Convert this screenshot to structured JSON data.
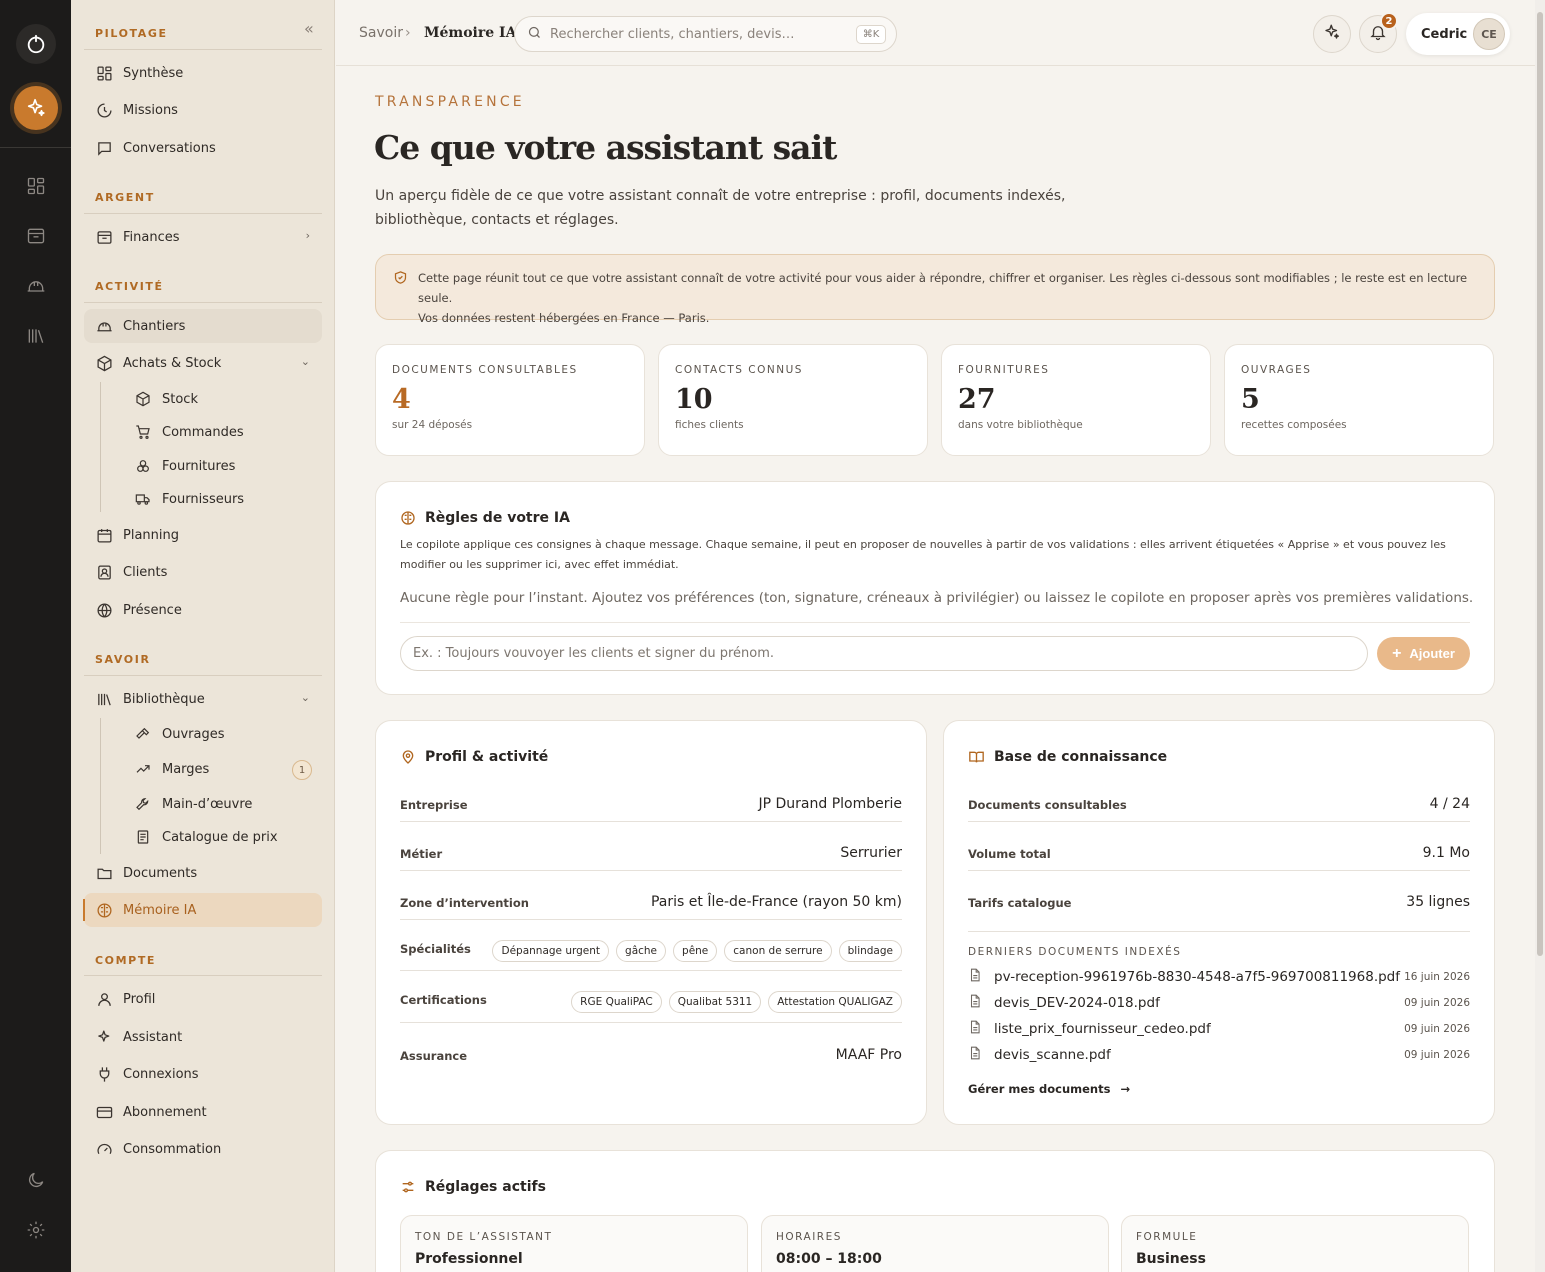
{
  "sidebar": {
    "sections": {
      "pilotage": "PILOTAGE",
      "argent": "ARGENT",
      "activite": "ACTIVITÉ",
      "savoir": "SAVOIR",
      "compte": "COMPTE"
    },
    "items": {
      "synthese": "Synthèse",
      "missions": "Missions",
      "conversations": "Conversations",
      "finances": "Finances",
      "chantiers": "Chantiers",
      "achats": "Achats & Stock",
      "stock": "Stock",
      "commandes": "Commandes",
      "fournitures": "Fournitures",
      "fournisseurs": "Fournisseurs",
      "planning": "Planning",
      "clients": "Clients",
      "presence": "Présence",
      "bibliotheque": "Bibliothèque",
      "ouvrages": "Ouvrages",
      "marges": "Marges",
      "marges_count": "1",
      "main_oeuvre": "Main-d’œuvre",
      "catalogue": "Catalogue de prix",
      "documents": "Documents",
      "memoire": "Mémoire IA",
      "profil": "Profil",
      "assistant": "Assistant",
      "connexions": "Connexions",
      "abonnement": "Abonnement",
      "consommation": "Consommation"
    }
  },
  "header": {
    "breadcrumb_parent": "Savoir",
    "breadcrumb_current": "Mémoire IA",
    "search_placeholder": "Rechercher clients, chantiers, devis…",
    "search_kbd": "⌘K",
    "notif_count": "2",
    "user_name": "Cedric",
    "user_initials": "CE"
  },
  "page": {
    "eyebrow": "TRANSPARENCE",
    "title": "Ce que votre assistant sait",
    "lead": "Un aperçu fidèle de ce que votre assistant connaît de votre entreprise : profil, documents indexés, bibliothèque, contacts et réglages.",
    "notice_line1": "Cette page réunit tout ce que votre assistant connaît de votre activité pour vous aider à répondre, chiffrer et organiser. Les règles ci-dessous sont modifiables ; le reste est en lecture seule.",
    "notice_line2": "Vos données restent hébergées en France — Paris."
  },
  "stats": [
    {
      "label": "DOCUMENTS CONSULTABLES",
      "value": "4",
      "caption": "sur 24 déposés"
    },
    {
      "label": "CONTACTS CONNUS",
      "value": "10",
      "caption": "fiches clients"
    },
    {
      "label": "FOURNITURES",
      "value": "27",
      "caption": "dans votre bibliothèque"
    },
    {
      "label": "OUVRAGES",
      "value": "5",
      "caption": "recettes composées"
    }
  ],
  "rules": {
    "title": "Règles de votre IA",
    "description": "Le copilote applique ces consignes à chaque message. Chaque semaine, il peut en proposer de nouvelles à partir de vos validations : elles arrivent étiquetées « Apprise » et vous pouvez les modifier ou les supprimer ici, avec effet immédiat.",
    "empty": "Aucune règle pour l’instant. Ajoutez vos préférences (ton, signature, créneaux à privilégier) ou laissez le copilote en proposer après vos premières validations.",
    "input_placeholder": "Ex. : Toujours vouvoyer les clients et signer du prénom.",
    "add_label": "Ajouter"
  },
  "profile": {
    "title": "Profil & activité",
    "entreprise_label": "Entreprise",
    "entreprise_value": "JP Durand Plomberie",
    "metier_label": "Métier",
    "metier_value": "Serrurier",
    "zone_label": "Zone d’intervention",
    "zone_value": "Paris et Île-de-France (rayon 50 km)",
    "specialites_label": "Spécialités",
    "specialites": [
      "Dépannage urgent",
      "gâche",
      "pêne",
      "canon de serrure",
      "blindage"
    ],
    "certifications_label": "Certifications",
    "certifications": [
      "RGE QualiPAC",
      "Qualibat 5311",
      "Attestation QUALIGAZ"
    ],
    "assurance_label": "Assurance",
    "assurance_value": "MAAF Pro"
  },
  "knowledge": {
    "title": "Base de connaissance",
    "docs_label": "Documents consultables",
    "docs_value": "4 / 24",
    "volume_label": "Volume total",
    "volume_value": "9.1 Mo",
    "tarifs_label": "Tarifs catalogue",
    "tarifs_value": "35 lignes",
    "recent_label": "DERNIERS DOCUMENTS INDEXÉS",
    "documents": [
      {
        "name": "pv-reception-9961976b-8830-4548-a7f5-969700811968.pdf",
        "date": "16 juin 2026"
      },
      {
        "name": "devis_DEV-2024-018.pdf",
        "date": "09 juin 2026"
      },
      {
        "name": "liste_prix_fournisseur_cedeo.pdf",
        "date": "09 juin 2026"
      },
      {
        "name": "devis_scanne.pdf",
        "date": "09 juin 2026"
      }
    ],
    "manage_label": "Gérer mes documents"
  },
  "settings": {
    "title": "Réglages actifs",
    "boxes": [
      {
        "label": "TON DE L’ASSISTANT",
        "value": "Professionnel"
      },
      {
        "label": "HORAIRES",
        "value": "08:00 – 18:00"
      },
      {
        "label": "FORMULE",
        "value": "Business"
      }
    ]
  },
  "colors": {
    "accent": "#c97a2d",
    "rail": "#1c1b1a",
    "sidebar": "#ece5d9",
    "background": "#f6f3ee"
  }
}
